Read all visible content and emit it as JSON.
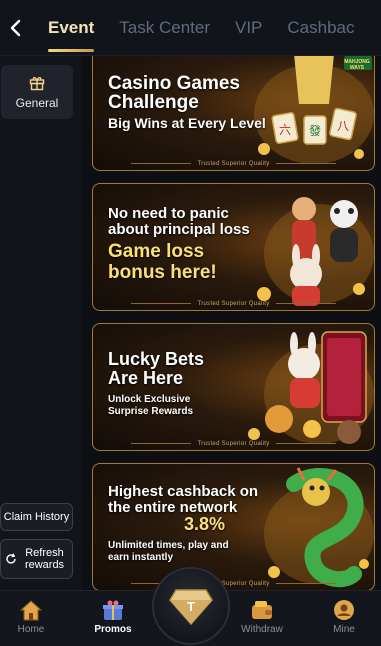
{
  "header": {
    "tabs": [
      {
        "label": "Event",
        "active": true
      },
      {
        "label": "Task Center",
        "active": false
      },
      {
        "label": "VIP",
        "active": false
      },
      {
        "label": "Cashbac",
        "active": false
      }
    ]
  },
  "sidebar": {
    "general_label": "General",
    "claim_history_label": "Claim History",
    "refresh_rewards_label": "Refresh rewards"
  },
  "banners": [
    {
      "title": "Casino Games Challenge",
      "subtitle": "Big Wins at Every Level",
      "footer": "Trusted Superior Quality",
      "badge": "MAHJONG WAYS"
    },
    {
      "title": "No need to panic about principal loss",
      "subtitle": "Game loss bonus here!",
      "footer": "Trusted Superior Quality"
    },
    {
      "title": "Lucky Bets Are Here",
      "subtitle": "Unlock Exclusive Surprise Rewards",
      "footer": "Trusted Superior Quality"
    },
    {
      "title": "Highest cashback on the entire network",
      "highlight": "3.8%",
      "subtitle": "Unlimited times, play and earn instantly",
      "footer": "Trusted Superior Quality"
    }
  ],
  "bottomnav": {
    "items": [
      {
        "label": "Home"
      },
      {
        "label": "Promos"
      },
      {
        "label": "Withdraw"
      },
      {
        "label": "Mine"
      }
    ]
  },
  "colors": {
    "accent_gold": "#f6d58b",
    "active_tab": "#f6e2b9",
    "inactive_tab": "#5f6b7c",
    "background": "#0d0f14"
  }
}
